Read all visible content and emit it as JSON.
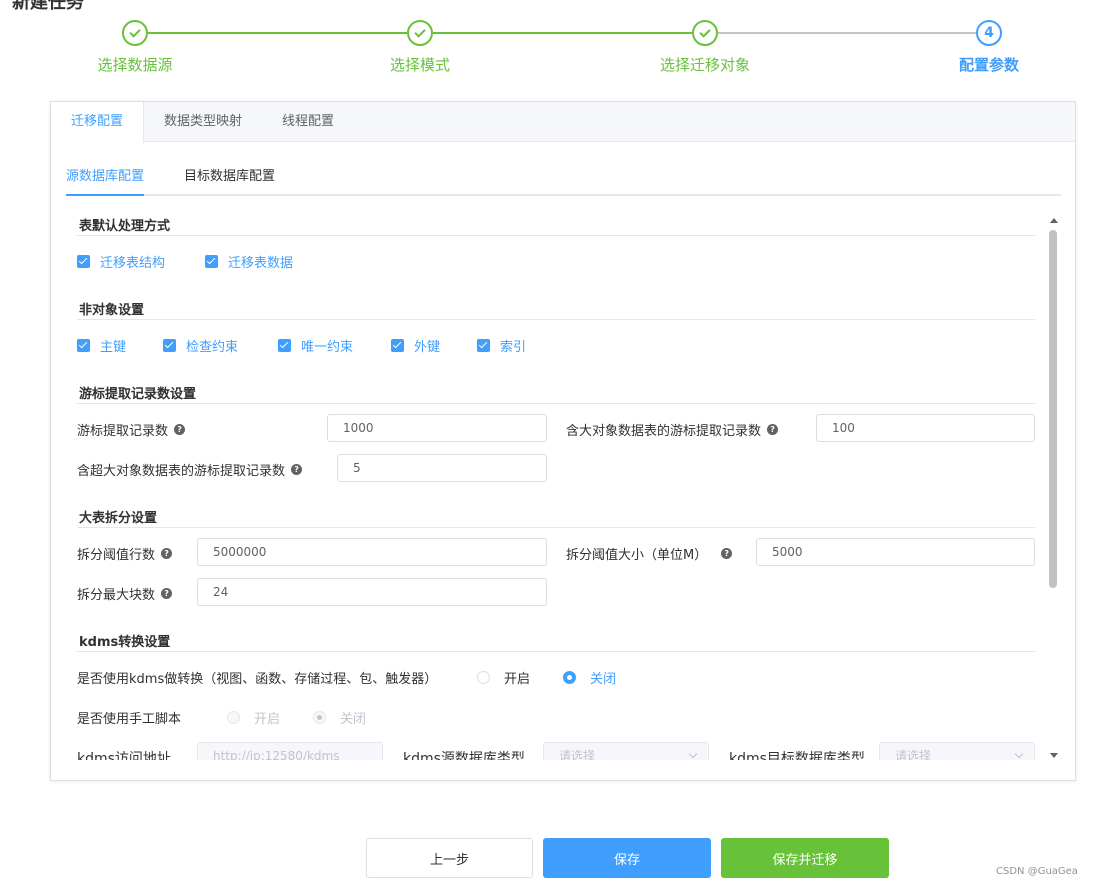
{
  "page_title": "新建任务",
  "steps": [
    {
      "label": "选择数据源",
      "status": "done"
    },
    {
      "label": "选择模式",
      "status": "done"
    },
    {
      "label": "选择迁移对象",
      "status": "done"
    },
    {
      "label": "配置参数",
      "status": "active",
      "number": "4"
    }
  ],
  "tabs": [
    "迁移配置",
    "数据类型映射",
    "线程配置"
  ],
  "subtabs": [
    "源数据库配置",
    "目标数据库配置"
  ],
  "sections": {
    "table_default": {
      "title": "表默认处理方式",
      "options": [
        "迁移表结构",
        "迁移表数据"
      ]
    },
    "non_object": {
      "title": "非对象设置",
      "options": [
        "主键",
        "检查约束",
        "唯一约束",
        "外键",
        "索引"
      ]
    },
    "cursor": {
      "title": "游标提取记录数设置",
      "fields": {
        "fetch_count": {
          "label": "游标提取记录数",
          "value": "1000"
        },
        "lob_fetch_count": {
          "label": "含大对象数据表的游标提取记录数",
          "value": "100"
        },
        "large_lob_fetch_count": {
          "label": "含超大对象数据表的游标提取记录数",
          "value": "5"
        }
      }
    },
    "split": {
      "title": "大表拆分设置",
      "fields": {
        "rows_threshold": {
          "label": "拆分阈值行数",
          "value": "5000000"
        },
        "size_threshold": {
          "label": "拆分阈值大小（单位M）",
          "value": "5000"
        },
        "max_chunks": {
          "label": "拆分最大块数",
          "value": "24"
        }
      }
    },
    "kdms": {
      "title": "kdms转换设置",
      "use_kdms": {
        "label": "是否使用kdms做转换（视图、函数、存储过程、包、触发器）",
        "on": "开启",
        "off": "关闭",
        "selected": "off"
      },
      "manual_script": {
        "label": "是否使用手工脚本",
        "on": "开启",
        "off": "关闭",
        "selected": "off"
      },
      "address": {
        "label": "kdms访问地址",
        "placeholder": "http://ip:12580/kdms"
      },
      "source_type": {
        "label": "kdms源数据库类型",
        "placeholder": "请选择"
      },
      "target_type": {
        "label": "kdms目标数据库类型",
        "placeholder": "请选择"
      }
    }
  },
  "buttons": {
    "prev": "上一步",
    "save": "保存",
    "save_migrate": "保存并迁移"
  },
  "watermark": "CSDN @GuaGea",
  "colors": {
    "primary": "#409eff",
    "success": "#67c23a"
  }
}
